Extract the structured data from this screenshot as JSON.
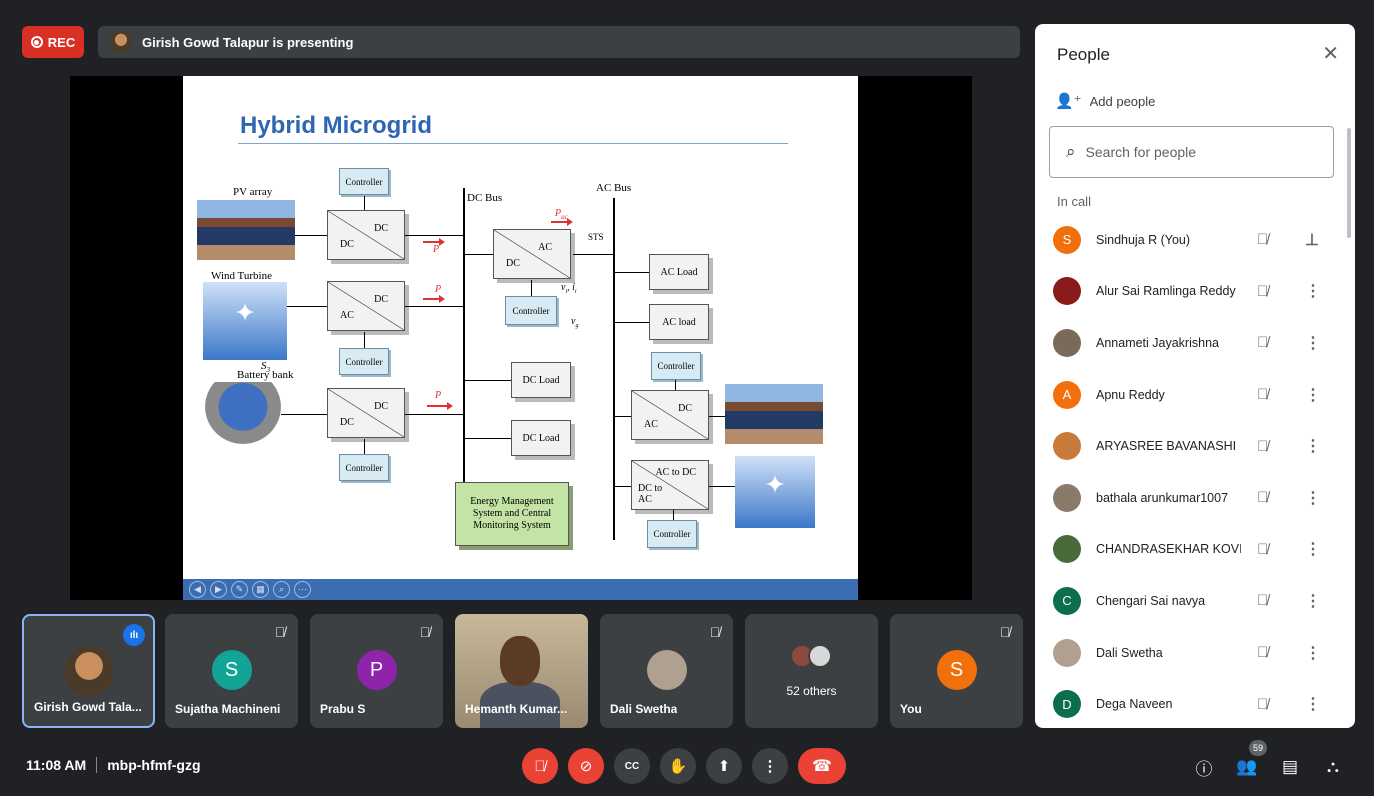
{
  "top": {
    "rec_label": "REC",
    "presenting_text": "Girish Gowd Talapur is presenting"
  },
  "slide": {
    "title": "Hybrid Microgrid",
    "labels": {
      "pv_array": "PV array",
      "wind_turbine": "Wind Turbine",
      "s3": "S",
      "s3_sub": "3",
      "battery_bank": "Battery bank",
      "dc_bus": "DC Bus",
      "ac_bus": "AC Bus",
      "sts": "STS",
      "vi": "v",
      "vi_sub": "i",
      "ii": ", i",
      "ii_sub": "i",
      "vg": "v",
      "vg_sub": "g",
      "p": "P",
      "pac": "P",
      "pac_sub": "ac"
    },
    "controllers": [
      "Controller",
      "Controller",
      "Controller",
      "Controller",
      "Controller",
      "Controller"
    ],
    "converter_dc": "DC",
    "converter_ac": "AC",
    "ac_to_dc": "AC to DC",
    "dc_to_ac": "DC to AC",
    "ac_load": "AC Load",
    "ac_load2": "AC load",
    "dc_load": "DC Load",
    "ems": "Energy Management System and Central Monitoring System"
  },
  "participants": [
    {
      "name": "Girish Gowd Tala...",
      "muted": false,
      "speaking": true
    },
    {
      "name": "Sujatha Machineni",
      "initial": "S",
      "color": "#12a596",
      "muted": true
    },
    {
      "name": "Prabu S",
      "initial": "P",
      "color": "#8e24aa",
      "muted": true
    },
    {
      "name": "Hemanth Kumar...",
      "muted": false
    },
    {
      "name": "Dali Swetha",
      "muted": true
    },
    {
      "others": "52 others"
    },
    {
      "name": "You",
      "initial": "S",
      "color": "#f2700c",
      "muted": true
    }
  ],
  "bottom": {
    "time": "11:08 AM",
    "meeting_code": "mbp-hfmf-gzg",
    "people_count": "59"
  },
  "panel": {
    "title": "People",
    "add_people": "Add people",
    "search_placeholder": "Search for people",
    "section": "In call",
    "people": [
      {
        "name": "Sindhuja R (You)",
        "initial": "S",
        "color": "#f2700c",
        "action": "pin-icon"
      },
      {
        "name": "Alur Sai Ramlinga Reddy",
        "color": "#8b1a1a",
        "action": "more-icon"
      },
      {
        "name": "Annameti Jayakrishna",
        "color": "#7a6a5a",
        "action": "more-icon"
      },
      {
        "name": "Apnu Reddy",
        "initial": "A",
        "color": "#f2700c",
        "action": "more-icon"
      },
      {
        "name": "ARYASREE BAVANASHI",
        "color": "#c97a3a",
        "action": "more-icon"
      },
      {
        "name": "bathala arunkumar1007",
        "color": "#8a7a6a",
        "action": "more-icon"
      },
      {
        "name": "CHANDRASEKHAR KOVI",
        "color": "#4a6a3a",
        "action": "more-icon"
      },
      {
        "name": "Chengari Sai navya",
        "initial": "C",
        "color": "#0b6e4f",
        "action": "more-icon"
      },
      {
        "name": "Dali Swetha",
        "color": "#b0a090",
        "action": "more-icon"
      },
      {
        "name": "Dega Naveen",
        "initial": "D",
        "color": "#0b6e4f",
        "action": "more-icon"
      }
    ]
  }
}
